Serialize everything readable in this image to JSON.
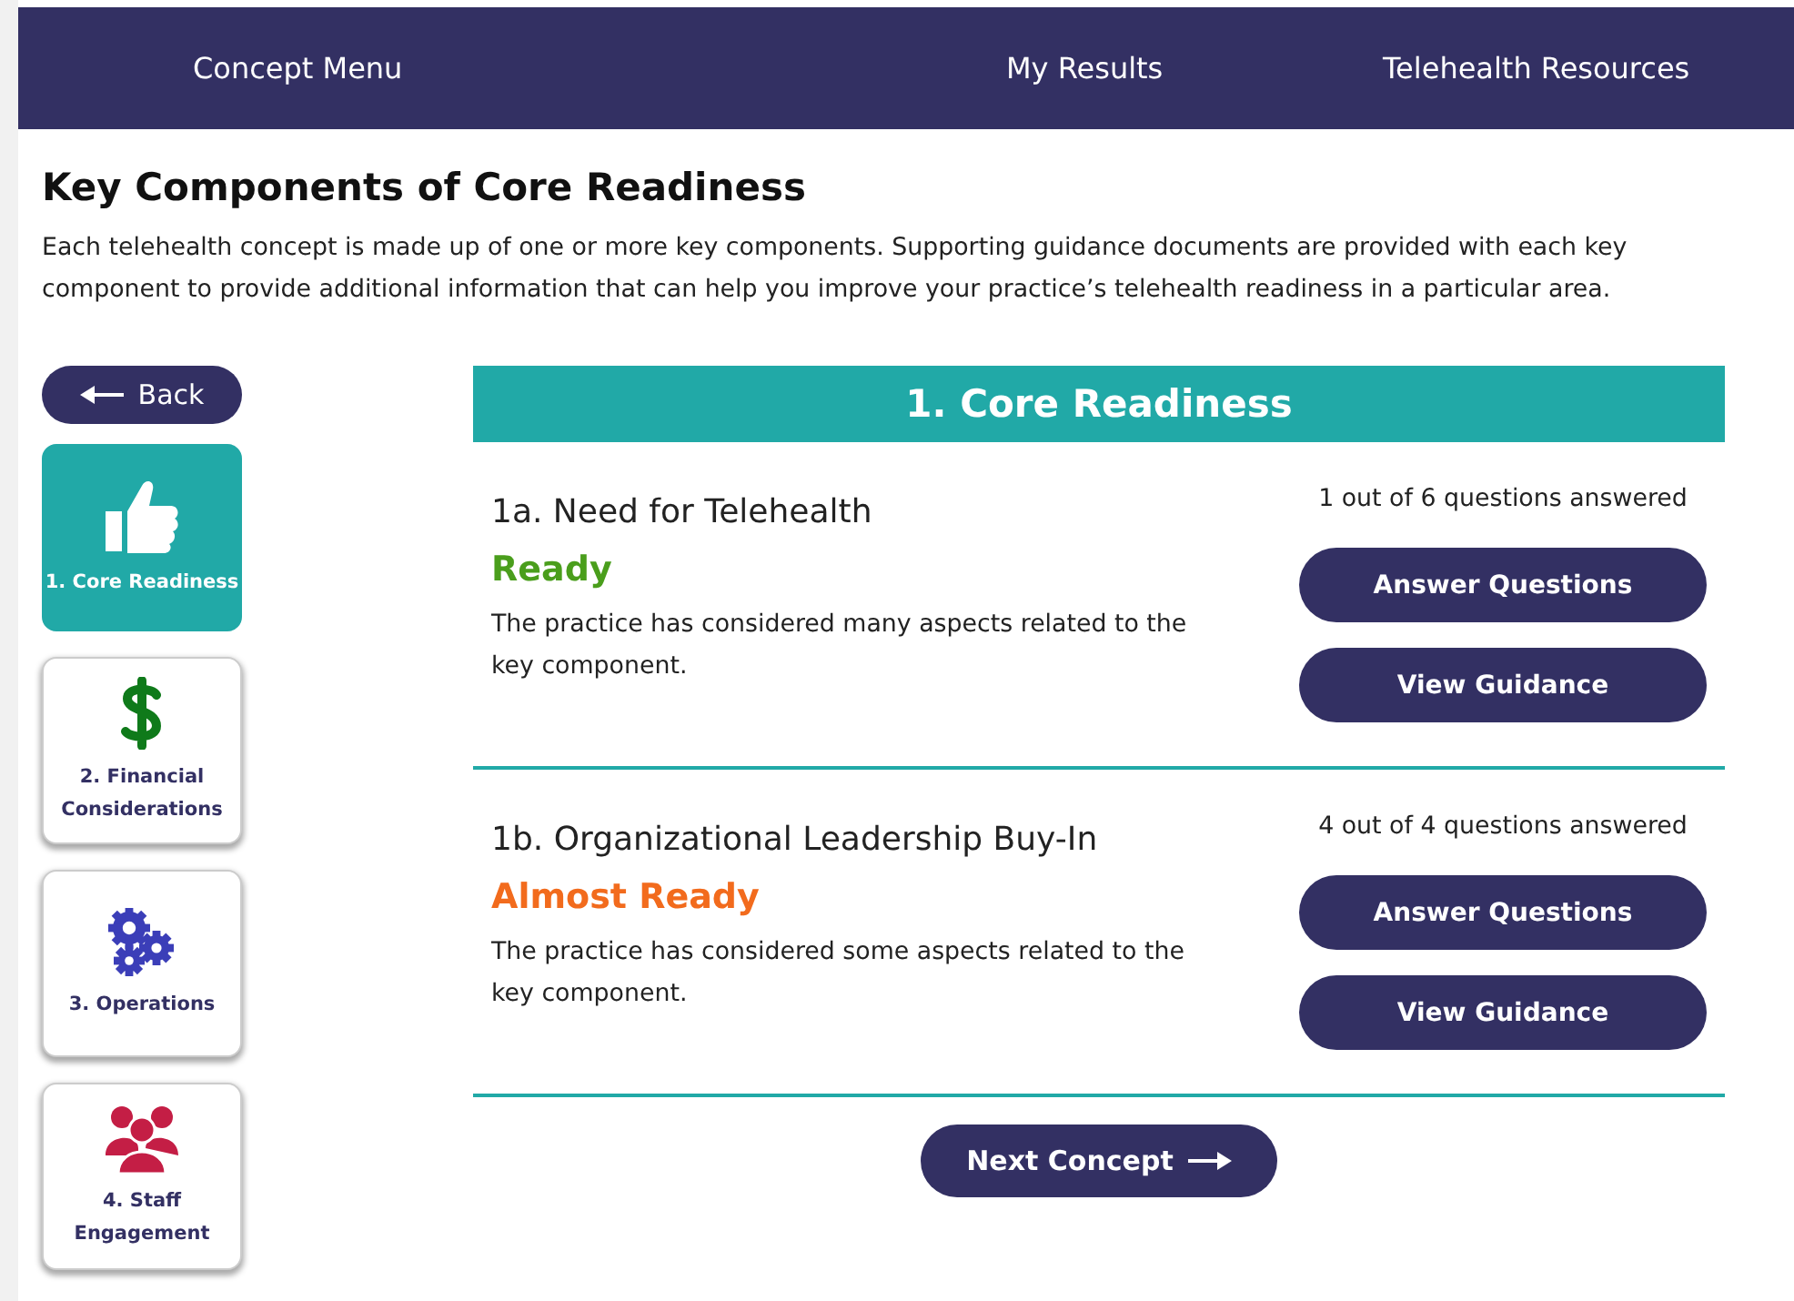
{
  "nav": [
    {
      "label": "Concept Menu"
    },
    {
      "label": "My Results"
    },
    {
      "label": "Telehealth Resources"
    }
  ],
  "page": {
    "title": "Key Components of Core Readiness",
    "intro": "Each telehealth concept is made up of one or more key components. Supporting guidance documents are provided with each key component to provide additional information that can help you improve your practice’s telehealth readiness in a particular area."
  },
  "back_button": {
    "label": "Back"
  },
  "concepts": [
    {
      "label": "1. Core Readiness",
      "kind": "thumb",
      "selected": true
    },
    {
      "label": "2. Financial Considerations",
      "kind": "dollar",
      "selected": false
    },
    {
      "label": "3. Operations",
      "kind": "gears",
      "selected": false
    },
    {
      "label": "4. Staff Engagement",
      "kind": "people",
      "selected": false
    }
  ],
  "concept_title": "1. Core Readiness",
  "components": [
    {
      "title": "1a. Need for Telehealth",
      "status": "Ready",
      "color": "#4a9e1c",
      "description": "The practice has considered many aspects related to the key component.",
      "progress": "1 out of 6 questions answered",
      "buttons": [
        "Answer Questions",
        "View Guidance"
      ]
    },
    {
      "title": "1b. Organizational Leadership Buy-In",
      "status": "Almost Ready",
      "color": "#f26b1d",
      "description": "The practice has considered some aspects related to the key component.",
      "progress": "4 out of 4 questions answered",
      "buttons": [
        "Answer Questions",
        "View Guidance"
      ]
    }
  ],
  "next_button": {
    "label": "Next Concept"
  }
}
